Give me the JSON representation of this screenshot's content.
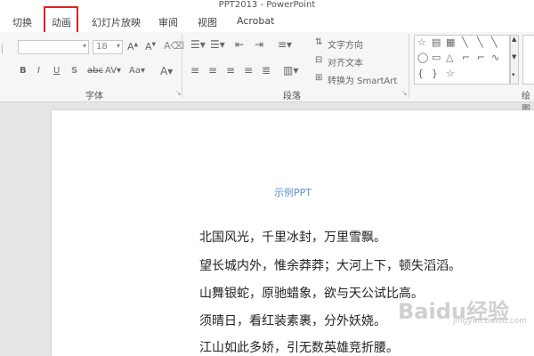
{
  "window": {
    "title": "PPT2013 - PowerPoint"
  },
  "tabs": [
    "切换",
    "动画",
    "幻灯片放映",
    "审阅",
    "视图",
    "Acrobat"
  ],
  "ribbon": {
    "font_name": "",
    "font_size": "18",
    "text_direction": "文字方向",
    "align_text": "对齐文本",
    "convert_smartart": "转换为 SmartArt",
    "group_font": "字体",
    "group_paragraph": "段落",
    "group_drawing": "绘图"
  },
  "slide": {
    "title": "示例PPT",
    "lines": [
      "北国风光，千里冰封，万里雪飘。",
      "望长城内外，惟余莽莽；大河上下，顿失滔滔。",
      "山舞银蛇，原驰蜡象，欲与天公试比高。",
      "须晴日，看红装素裹，分外妖娆。",
      "江山如此多娇，引无数英雄竞折腰。"
    ]
  },
  "watermark": {
    "text": "Baidu经验",
    "sub": "jingyan.baidu.com"
  },
  "colors": {
    "highlight_box": "#dd2222",
    "slide_title": "#5e8fc7"
  }
}
